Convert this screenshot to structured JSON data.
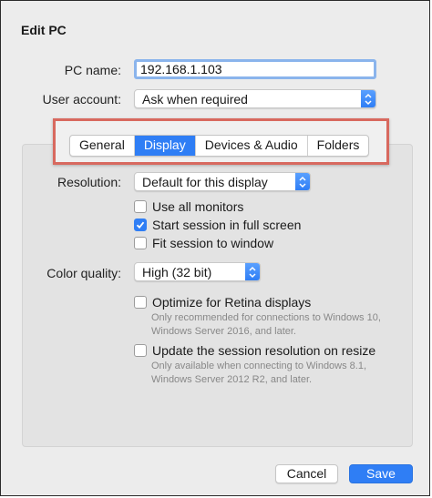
{
  "dialog": {
    "title": "Edit PC"
  },
  "pc_name": {
    "label": "PC name:",
    "value": "192.168.1.103"
  },
  "user_account": {
    "label": "User account:",
    "selected": "Ask when required"
  },
  "tabs": [
    {
      "label": "General",
      "active": false
    },
    {
      "label": "Display",
      "active": true
    },
    {
      "label": "Devices & Audio",
      "active": false
    },
    {
      "label": "Folders",
      "active": false
    }
  ],
  "display": {
    "resolution": {
      "label": "Resolution:",
      "selected": "Default for this display"
    },
    "checkboxes": [
      {
        "label": "Use all monitors",
        "checked": false
      },
      {
        "label": "Start session in full screen",
        "checked": true
      },
      {
        "label": "Fit session to window",
        "checked": false
      }
    ],
    "color_quality": {
      "label": "Color quality:",
      "selected": "High (32 bit)"
    },
    "retina": {
      "label": "Optimize for Retina displays",
      "checked": false,
      "note": "Only recommended for connections to Windows 10, Windows Server 2016, and later."
    },
    "resize": {
      "label": "Update the session resolution on resize",
      "checked": false,
      "note": "Only available when connecting to Windows 8.1, Windows Server 2012 R2, and later."
    }
  },
  "buttons": {
    "cancel": "Cancel",
    "save": "Save"
  },
  "colors": {
    "accent": "#2f7ef5",
    "highlight_border": "#d8695f",
    "focus_ring": "#8ab4ec"
  },
  "icons": {
    "stepper": "up-down-chevron-icon",
    "check": "checkmark-icon"
  }
}
